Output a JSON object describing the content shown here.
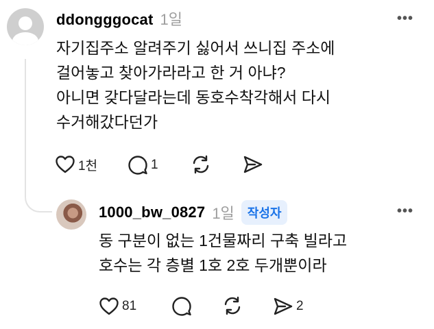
{
  "post": {
    "username": "ddongggocat",
    "time": "1일",
    "more": "•••",
    "lines": [
      "자기집주소 알려주기 싫어서 쓰니집 주소에",
      "걸어놓고 찾아가라라고 한 거 아냐?",
      "아니면 갖다달라는데 동호수착각해서 다시",
      "수거해갔다던가"
    ],
    "likes": "1천",
    "comments": "1"
  },
  "reply": {
    "username": "1000_bw_0827",
    "time": "1일",
    "badge": "작성자",
    "more": "•••",
    "lines": [
      "동 구분이 없는 1건물짜리 구축 빌라고",
      "호수는 각 층별 1호 2호 두개뿐이라"
    ],
    "likes": "81",
    "shares": "2"
  },
  "colors": {
    "badge_bg": "#e7f0fd",
    "badge_text": "#1a73e8",
    "muted": "#9e9e9e"
  }
}
